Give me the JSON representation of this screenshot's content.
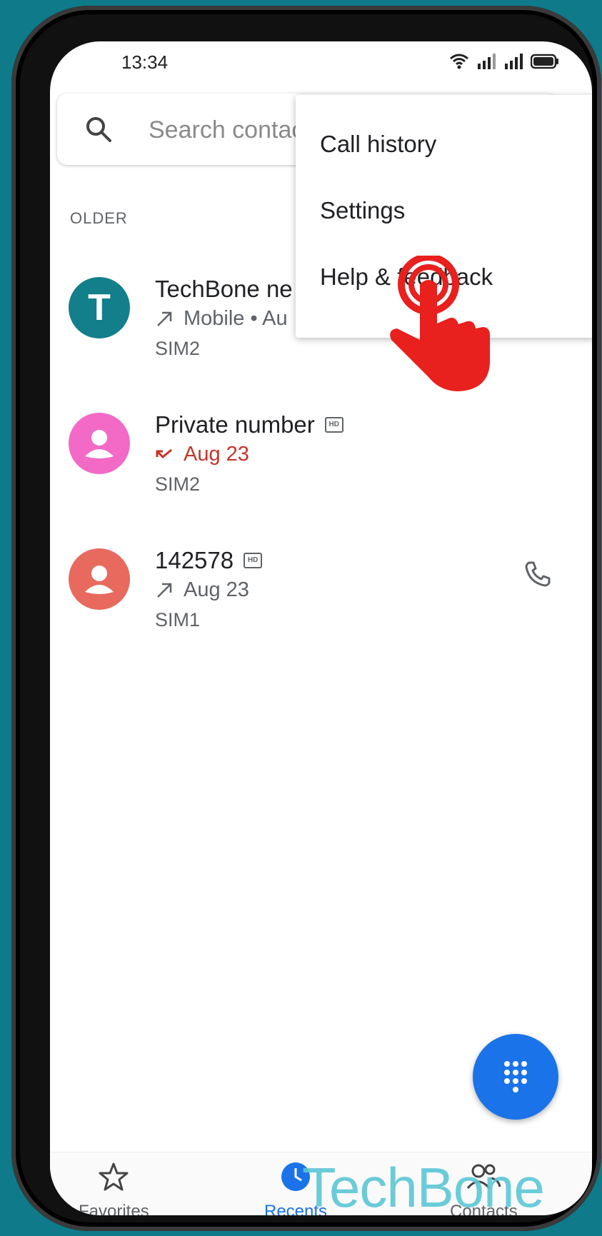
{
  "status_bar": {
    "time": "13:34"
  },
  "search": {
    "placeholder": "Search contac"
  },
  "section": {
    "header": "OLDER"
  },
  "calls": [
    {
      "name": "TechBone ne",
      "avatar_letter": "T",
      "avatar_color": "#127f8a",
      "direction": "outgoing",
      "detail": "Mobile • Au",
      "sim": "SIM2"
    },
    {
      "name": "Private number",
      "avatar_color": "#f36ac6",
      "direction": "missed",
      "detail": "Aug 23",
      "sim": "SIM2",
      "hd": true
    },
    {
      "name": "142578",
      "avatar_color": "#e86a5e",
      "direction": "outgoing",
      "detail": "Aug 23",
      "sim": "SIM1",
      "hd": true
    }
  ],
  "menu": {
    "items": [
      "Call history",
      "Settings",
      "Help & feedback"
    ]
  },
  "bottom_nav": {
    "items": [
      {
        "label": "Favorites",
        "icon": "star-icon"
      },
      {
        "label": "Recents",
        "icon": "clock-icon",
        "active": true
      },
      {
        "label": "Contacts",
        "icon": "people-icon"
      }
    ]
  },
  "watermark": "TechBone",
  "colors": {
    "accent": "#1a73e8",
    "missed": "#c5352b",
    "background": "#0f7a89"
  }
}
